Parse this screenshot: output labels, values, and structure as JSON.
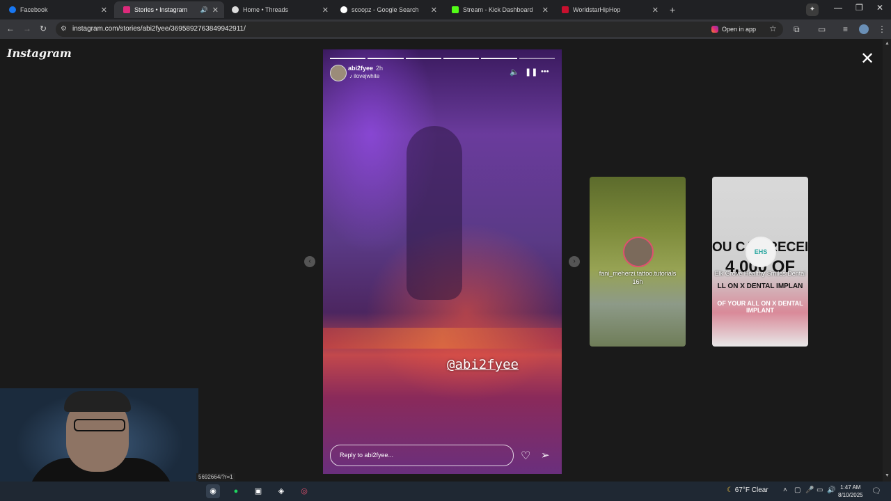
{
  "browser": {
    "tabs": [
      {
        "title": "Facebook",
        "color": "#1877f2"
      },
      {
        "title": "Stories • Instagram",
        "color": "#dd2a7b"
      },
      {
        "title": "Home • Threads",
        "color": "#dddddd"
      },
      {
        "title": "scoopz - Google Search",
        "color": "#ffffff"
      },
      {
        "title": "Stream - Kick Dashboard",
        "color": "#53fc18"
      },
      {
        "title": "WorldstarHipHop",
        "color": "#c8102e"
      }
    ],
    "url": "instagram.com/stories/abi2fyee/3695892763849942911/",
    "open_in_app": "Open in app"
  },
  "instagram": {
    "logo": "Instagram",
    "story": {
      "username": "abi2fyee",
      "time": "2h",
      "music": "ilovejwhite",
      "mention": "@abi2fyee",
      "reply_placeholder": "Reply to abi2fyee..."
    },
    "previews": [
      {
        "username": "fani_meherzi.tattoo.tutorials",
        "time": "16h"
      },
      {
        "username": "Elk Grove Healthy Smiles Dental",
        "badge": "EHS",
        "promo_line1": "OU CAN RECEIV",
        "promo_line2": "4,000 OF",
        "promo_line3": "LL ON X DENTAL IMPLAN",
        "promo_line4": "OF YOUR ALL ON X DENTAL IMPLANT"
      }
    ]
  },
  "status_url": "5692664/?r=1",
  "taskbar": {
    "weather": "67°F  Clear",
    "time": "1:47 AM",
    "date": "8/10/2025"
  }
}
